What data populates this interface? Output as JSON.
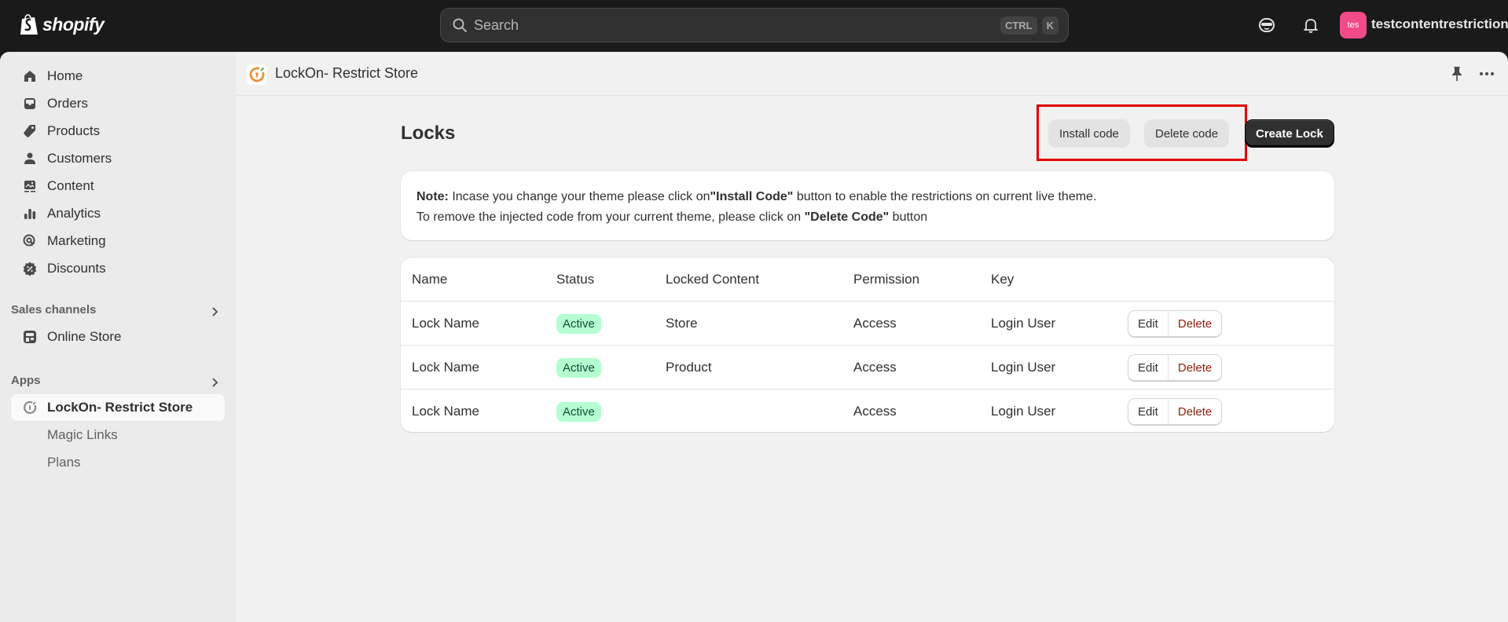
{
  "topbar": {
    "logo_text": "shopify",
    "search_placeholder": "Search",
    "shortcut_keys": [
      "CTRL",
      "K"
    ],
    "avatar_initials": "tes",
    "avatar_color": "#f34a8a",
    "store_name": "testcontentrestriction"
  },
  "sidebar": {
    "items": [
      {
        "label": "Home",
        "icon": "home-icon"
      },
      {
        "label": "Orders",
        "icon": "inbox-icon"
      },
      {
        "label": "Products",
        "icon": "tag-icon"
      },
      {
        "label": "Customers",
        "icon": "person-icon"
      },
      {
        "label": "Content",
        "icon": "image-icon"
      },
      {
        "label": "Analytics",
        "icon": "bar-chart-icon"
      },
      {
        "label": "Marketing",
        "icon": "target-icon"
      },
      {
        "label": "Discounts",
        "icon": "discount-icon"
      }
    ],
    "sales_channels": {
      "title": "Sales channels",
      "items": [
        {
          "label": "Online Store",
          "icon": "store-icon"
        }
      ]
    },
    "apps": {
      "title": "Apps",
      "active_app": "LockOn- Restrict Store",
      "sub_items": [
        "Magic Links",
        "Plans"
      ]
    }
  },
  "app_header": {
    "title": "LockOn- Restrict Store"
  },
  "page": {
    "title": "Locks",
    "install_code_label": "Install code",
    "delete_code_label": "Delete code",
    "create_lock_label": "Create Lock",
    "highlight_color": "#e00000"
  },
  "note": {
    "label": "Note:",
    "line1_text": " Incase you change your theme please click on",
    "line1_bold": "\"Install Code\"",
    "line1_end": " button to enable the restrictions on current live theme.",
    "line2_text": "To remove the injected code from your current theme, please click on ",
    "line2_bold": "\"Delete Code\"",
    "line2_end": " button"
  },
  "table": {
    "headers": [
      "Name",
      "Status",
      "Locked Content",
      "Permission",
      "Key"
    ],
    "rows": [
      {
        "name": "Lock Name",
        "status": "Active",
        "locked_content": "Store",
        "permission": "Access",
        "key": "Login User",
        "edit": "Edit",
        "delete": "Delete"
      },
      {
        "name": "Lock Name",
        "status": "Active",
        "locked_content": "Product",
        "permission": "Access",
        "key": "Login User",
        "edit": "Edit",
        "delete": "Delete"
      },
      {
        "name": "Lock Name",
        "status": "Active",
        "locked_content": "",
        "permission": "Access",
        "key": "Login User",
        "edit": "Edit",
        "delete": "Delete"
      }
    ]
  }
}
